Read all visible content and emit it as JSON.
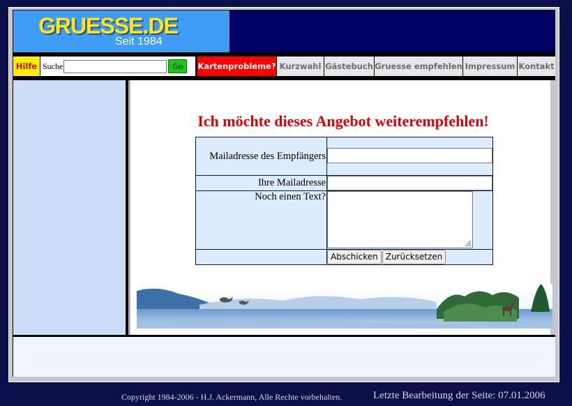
{
  "header": {
    "logo_text": "GRUESSE.DE",
    "tagline": "Seit 1984"
  },
  "nav": {
    "help": "Hilfe",
    "search_label": "Suche",
    "search_value": "",
    "go_label": "Go",
    "items": [
      "Kartenprobleme?",
      "Kurzwahl",
      "Gästebuch",
      "Gruesse empfehlen",
      "Impressum",
      "Kontakt"
    ]
  },
  "main": {
    "heading": "Ich möchte dieses Angebot weiterempfehlen!",
    "form": {
      "recipient_label": "Mailadresse des Empfängers",
      "recipient_value": "",
      "own_label": "Ihre Mailadresse",
      "own_value": "",
      "text_label": "Noch einen Text?",
      "text_value": "",
      "submit_label": "Abschicken",
      "reset_label": "Zurücksetzen"
    }
  },
  "footer": {
    "copyright": "Copyright 1984-2006 - H.J. Ackermann, Alle Rechte vorbehalten.",
    "last_edit": "Letzte Bearbeitung der Seite: 07.01.2006"
  },
  "colors": {
    "brand_blue": "#3f9df8",
    "navy": "#000066",
    "logo_yellow": "#ffe418",
    "heading_red": "#e00000",
    "form_bg": "#dcebfd"
  }
}
